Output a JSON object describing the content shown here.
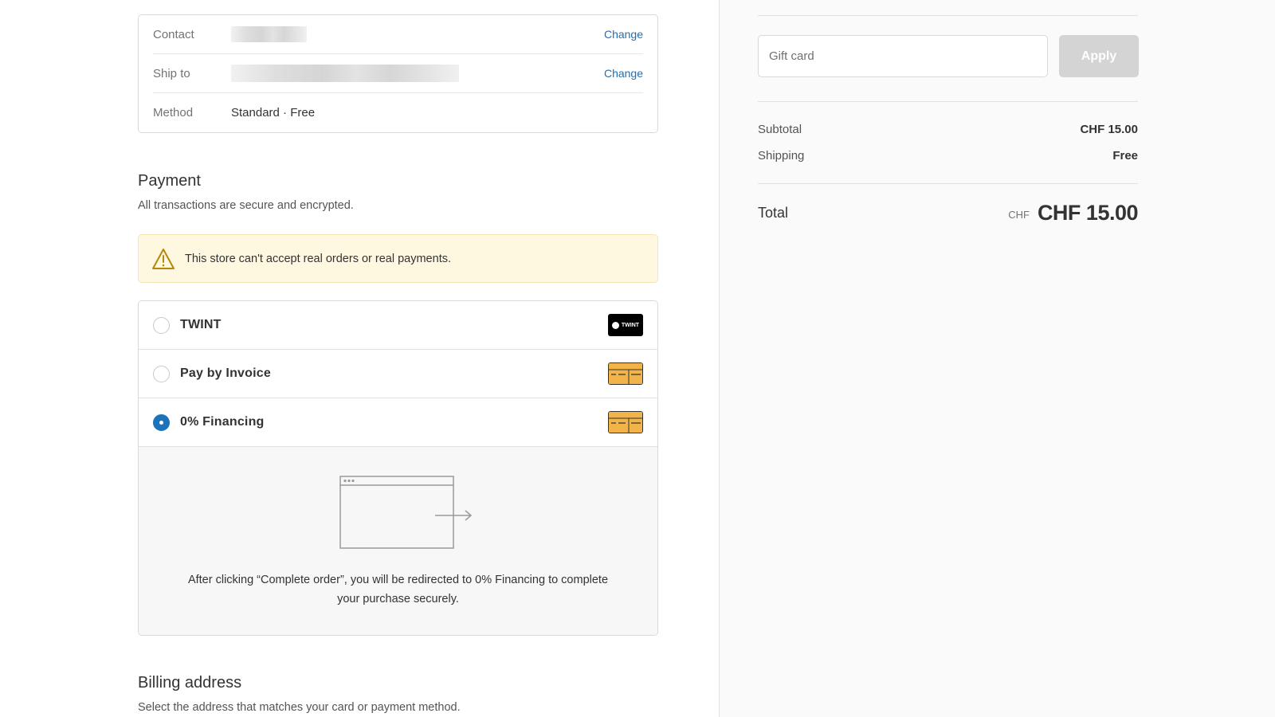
{
  "review": {
    "contact_label": "Contact",
    "ship_to_label": "Ship to",
    "method_label": "Method",
    "method_value": "Standard · Free",
    "change_label": "Change"
  },
  "payment": {
    "title": "Payment",
    "subtitle": "All transactions are secure and encrypted.",
    "warning": "This store can't accept real orders or real payments.",
    "methods": [
      {
        "label": "TWINT",
        "selected": false,
        "logo": "TWINT"
      },
      {
        "label": "Pay by Invoice",
        "selected": false,
        "logo": "generic-card-icon"
      },
      {
        "label": "0% Financing",
        "selected": true,
        "logo": "generic-card-icon"
      }
    ],
    "redirect_text": "After clicking “Complete order”, you will be redirected to 0% Financing to complete your purchase securely."
  },
  "billing": {
    "title": "Billing address",
    "subtitle": "Select the address that matches your card or payment method."
  },
  "sidebar": {
    "gift_placeholder": "Gift card",
    "apply_label": "Apply",
    "subtotal_label": "Subtotal",
    "subtotal_value": "CHF 15.00",
    "shipping_label": "Shipping",
    "shipping_value": "Free",
    "total_label": "Total",
    "total_currency": "CHF",
    "total_value": "CHF 15.00"
  },
  "colors": {
    "link": "#1f6fb2",
    "radio_selected": "#1d73b9",
    "warning_bg": "#fff8e1",
    "warning_icon": "#b7860b",
    "card_icon": "#f2b449"
  }
}
